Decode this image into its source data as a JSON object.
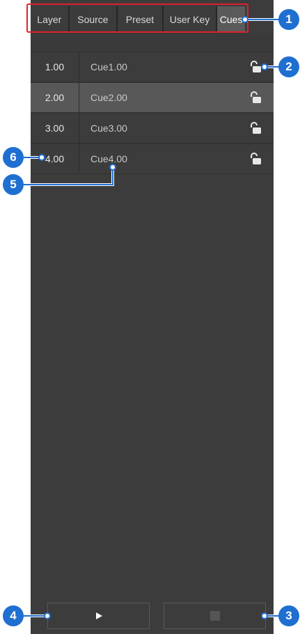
{
  "tabs": [
    {
      "label": "Layer"
    },
    {
      "label": "Source"
    },
    {
      "label": "Preset"
    },
    {
      "label": "User Key"
    },
    {
      "label": "Cues"
    }
  ],
  "active_tab": "Cues",
  "cues": [
    {
      "number": "1.00",
      "name": "Cue1.00"
    },
    {
      "number": "2.00",
      "name": "Cue2.00",
      "selected": true
    },
    {
      "number": "3.00",
      "name": "Cue3.00"
    },
    {
      "number": "4.00",
      "name": "Cue4.00"
    }
  ],
  "callouts": [
    "1",
    "2",
    "3",
    "4",
    "5",
    "6"
  ],
  "colors": {
    "panel": "#3c3c3c",
    "selected_row": "#585858",
    "callout": "#1f6fd1",
    "highlight_outline": "#e0212d"
  }
}
